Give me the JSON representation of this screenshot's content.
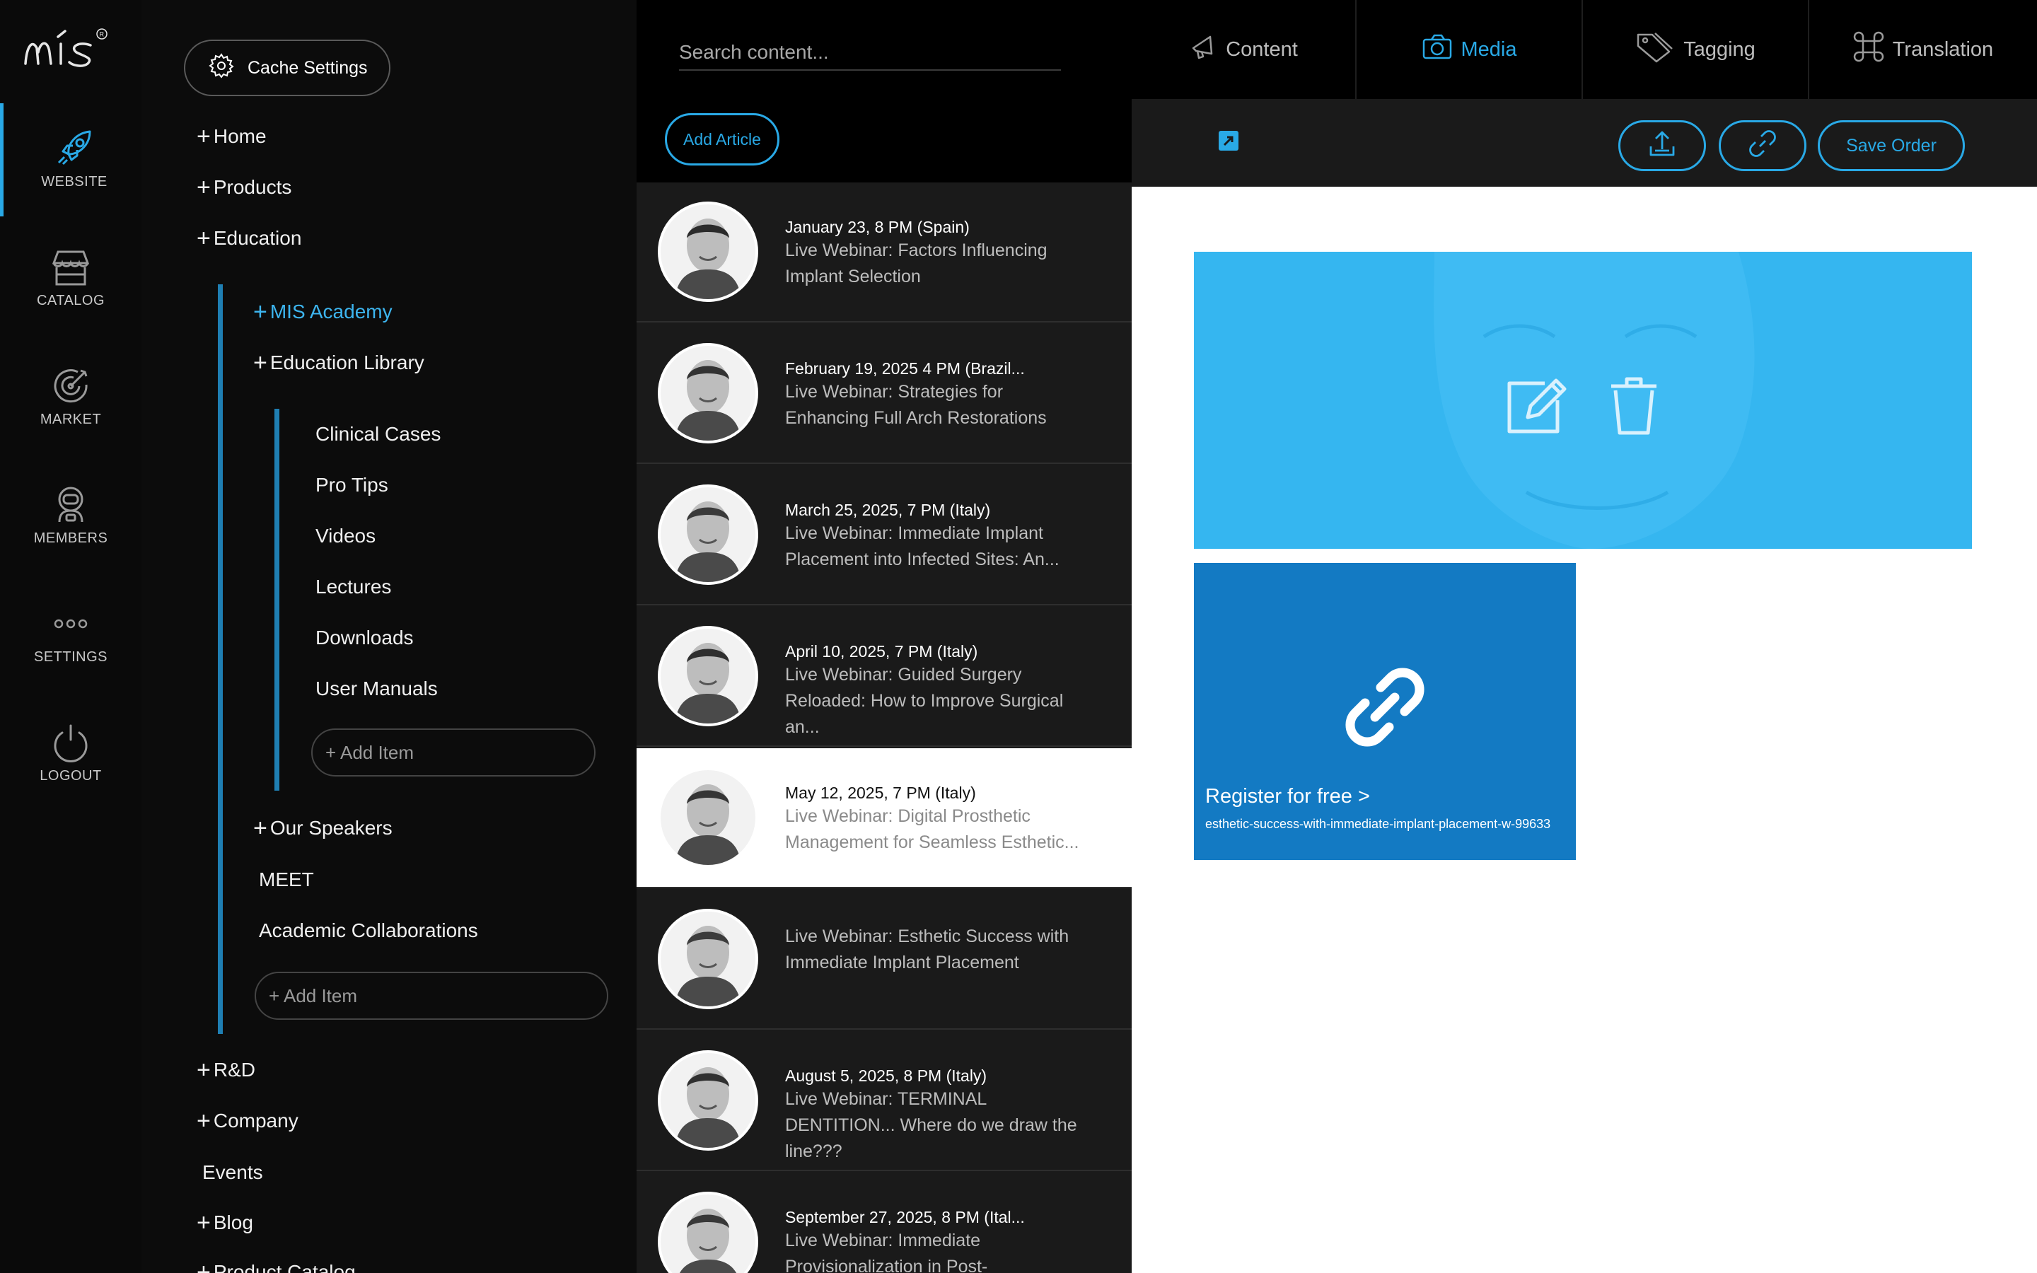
{
  "app": {
    "logo_text": "mis"
  },
  "rail": [
    {
      "key": "website",
      "label": "WEBSITE",
      "icon": "rocket-icon",
      "active": true
    },
    {
      "key": "catalog",
      "label": "CATALOG",
      "icon": "store-icon"
    },
    {
      "key": "market",
      "label": "MARKET",
      "icon": "target-icon"
    },
    {
      "key": "members",
      "label": "MEMBERS",
      "icon": "astronaut-icon"
    },
    {
      "key": "settings",
      "label": "SETTINGS",
      "icon": "dots-icon"
    },
    {
      "key": "logout",
      "label": "LOGOUT",
      "icon": "power-icon"
    }
  ],
  "tree": {
    "cache_label": "Cache Settings",
    "home": "Home",
    "products": "Products",
    "education": "Education",
    "mis_academy": "MIS Academy",
    "education_library": "Education Library",
    "library_items": [
      "Clinical Cases",
      "Pro Tips",
      "Videos",
      "Lectures",
      "Downloads",
      "User Manuals"
    ],
    "add_item_placeholder": "+ Add Item",
    "our_speakers": "Our Speakers",
    "meet": "MEET",
    "academic": "Academic Collaborations",
    "rnd": "R&D",
    "company": "Company",
    "events": "Events",
    "blog": "Blog",
    "product_catalog": "Product Catalog"
  },
  "list": {
    "search_placeholder": "Search content...",
    "add_article": "Add Article",
    "articles": [
      {
        "date": "January 23, 8 PM (Spain)",
        "title": "Live Webinar: Factors Influencing Implant Selection"
      },
      {
        "date": "February 19, 2025 4 PM (Brazil...",
        "title": "Live Webinar: Strategies for Enhancing Full Arch Restorations"
      },
      {
        "date": "March 25, 2025, 7 PM (Italy)",
        "title": "Live Webinar: Immediate Implant Placement into Infected Sites: An..."
      },
      {
        "date": "April 10, 2025, 7 PM (Italy)",
        "title": "Live Webinar: Guided Surgery Reloaded: How to Improve Surgical an..."
      },
      {
        "date": "May 12, 2025, 7 PM (Italy)",
        "title": "Live Webinar: Digital Prosthetic Management for Seamless Esthetic...",
        "selected": true
      },
      {
        "date": "",
        "title": "Live Webinar: Esthetic Success with Immediate Implant Placement"
      },
      {
        "date": "August 5, 2025, 8 PM (Italy)",
        "title": "Live Webinar: TERMINAL DENTITION... Where do we draw the line???"
      },
      {
        "date": "September 27, 2025, 8 PM (Ital...",
        "title": "Live Webinar: Immediate Provisionalization in Post-"
      }
    ]
  },
  "nav": {
    "tabs": [
      {
        "label": "Content",
        "icon": "megaphone-icon"
      },
      {
        "label": "Media",
        "icon": "camera-icon",
        "active": true
      },
      {
        "label": "Tagging",
        "icon": "tag-icon"
      },
      {
        "label": "Translation",
        "icon": "command-icon"
      }
    ]
  },
  "toolbar": {
    "save_order": "Save Order",
    "upload_icon": "upload-icon",
    "link_icon": "link-icon",
    "edit_icon": "external-edit-icon"
  },
  "media": {
    "hero_actions": [
      "edit-icon",
      "trash-icon"
    ],
    "link_cta": "Register for free >",
    "link_slug": "esthetic-success-with-immediate-implant-placement-w-99633"
  },
  "colors": {
    "accent": "#29a9e6",
    "hero_bg": "#35b6f0",
    "link_card_bg": "#137ac3"
  }
}
